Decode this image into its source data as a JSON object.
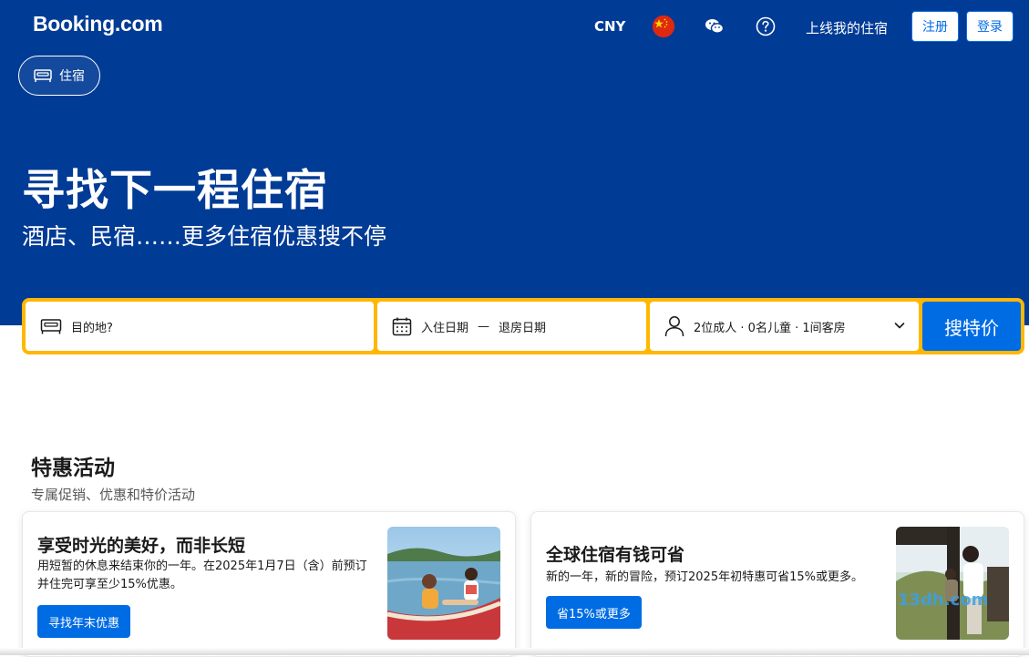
{
  "header": {
    "logo": "Booking.com",
    "currency": "CNY",
    "list_property": "上线我的住宿",
    "register": "注册",
    "login": "登录"
  },
  "nav": {
    "stays_tab": "住宿"
  },
  "hero": {
    "title": "寻找下一程住宿",
    "subtitle": "酒店、民宿……更多住宿优惠搜不停"
  },
  "search": {
    "destination_placeholder": "目的地?",
    "checkin": "入住日期",
    "date_separator": "—",
    "checkout": "退房日期",
    "guests": "2位成人 · 0名儿童 · 1间客房",
    "search_button": "搜特价"
  },
  "deals": {
    "title": "特惠活动",
    "subtitle": "专属促销、优惠和特价活动",
    "cards": [
      {
        "title": "享受时光的美好，而非长短",
        "desc": "用短暂的休息来结束你的一年。在2025年1月7日（含）前预订并住完可享至少15%优惠。",
        "button": "寻找年末优惠"
      },
      {
        "title": "全球住宿有钱可省",
        "desc": "新的一年，新的冒险，预订2025年初特惠可省15%或更多。",
        "button": "省15%或更多",
        "watermark": "13dh.com"
      }
    ]
  },
  "colors": {
    "brand_blue": "#003b95",
    "action_blue": "#006ce4",
    "search_border": "#ffb700"
  },
  "icons": {
    "flag": "china-flag-icon",
    "wechat": "wechat-icon",
    "help": "help-icon",
    "bed": "bed-icon",
    "calendar": "calendar-icon",
    "person": "person-icon",
    "chevron": "chevron-down-icon"
  }
}
